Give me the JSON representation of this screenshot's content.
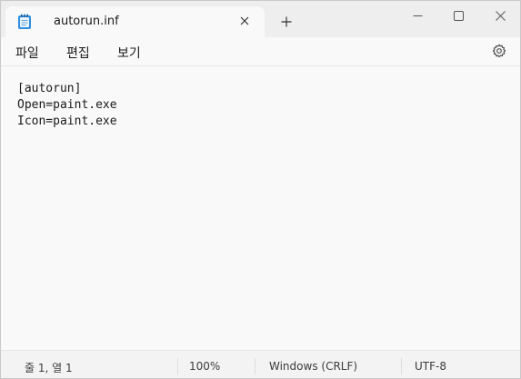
{
  "tab": {
    "title": "autorun.inf",
    "icon": "notepad-icon"
  },
  "titlebar": {
    "new_tab_icon": "plus-icon",
    "minimize_icon": "minimize-icon",
    "maximize_icon": "maximize-icon",
    "close_icon": "close-icon"
  },
  "menu": {
    "file": "파일",
    "edit": "편집",
    "view": "보기",
    "settings_icon": "gear-icon"
  },
  "editor": {
    "lines": [
      "[autorun]",
      "Open=paint.exe",
      "Icon=paint.exe"
    ]
  },
  "status": {
    "position": "줄 1, 열 1",
    "zoom": "100%",
    "line_ending": "Windows (CRLF)",
    "encoding": "UTF-8"
  }
}
